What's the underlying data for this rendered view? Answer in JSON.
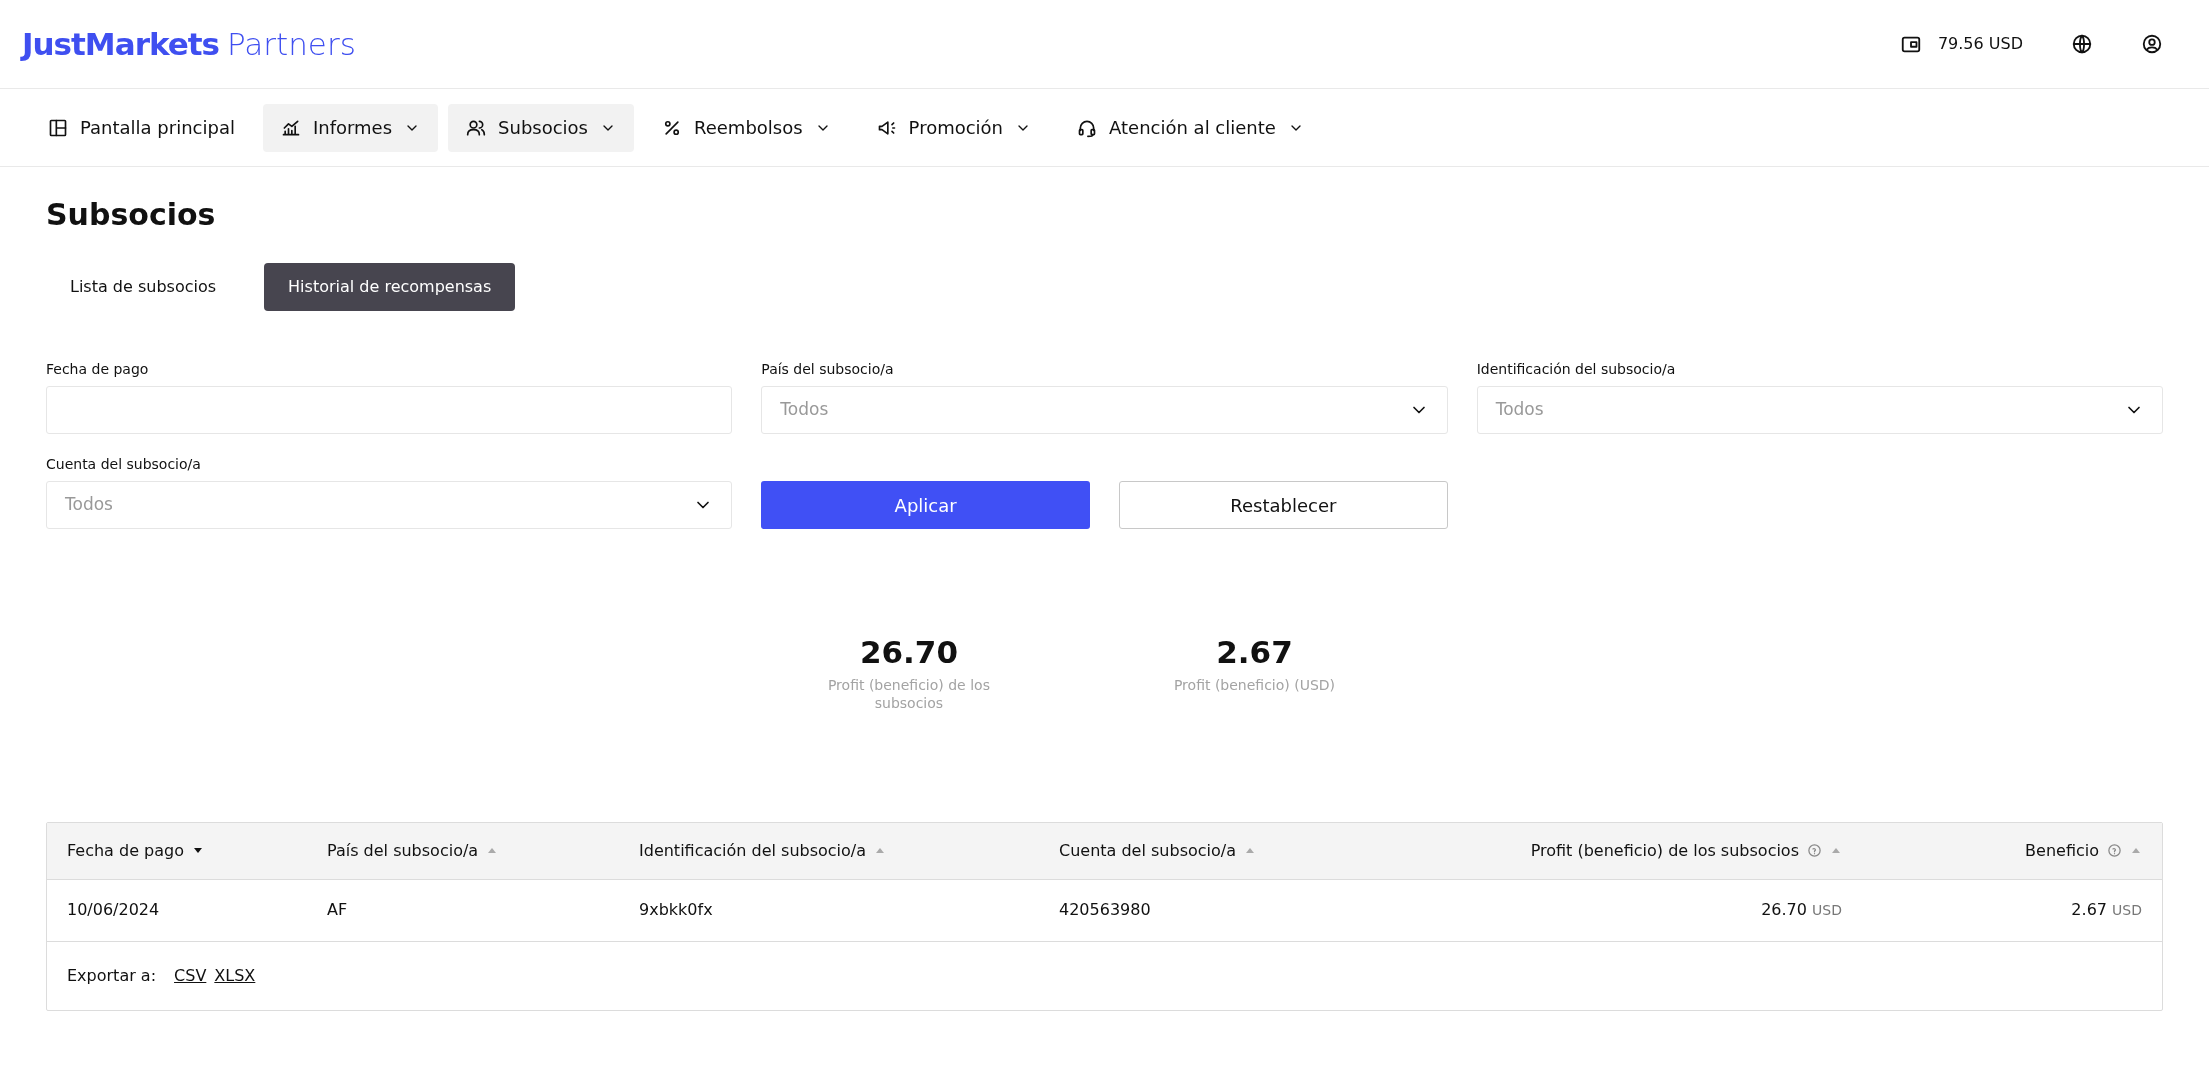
{
  "logo": {
    "brand": "JustMarkets",
    "suffix": "Partners"
  },
  "header": {
    "balance": "79.56 USD"
  },
  "nav": [
    {
      "label": "Pantalla principal",
      "dropdown": false,
      "selected": false
    },
    {
      "label": "Informes",
      "dropdown": true,
      "selected": true
    },
    {
      "label": "Subsocios",
      "dropdown": true,
      "selected": true
    },
    {
      "label": "Reembolsos",
      "dropdown": true,
      "selected": false
    },
    {
      "label": "Promoción",
      "dropdown": true,
      "selected": false
    },
    {
      "label": "Atención al cliente",
      "dropdown": true,
      "selected": false
    }
  ],
  "page_title": "Subsocios",
  "tabs": [
    {
      "label": "Lista de subsocios",
      "selected": false
    },
    {
      "label": "Historial de recompensas",
      "selected": true
    }
  ],
  "filters": [
    {
      "kind": "input",
      "label": "Fecha de pago"
    },
    {
      "kind": "select",
      "label": "País del subsocio/a",
      "placeholder": "Todos"
    },
    {
      "kind": "select",
      "label": "Identificación del subsocio/a",
      "placeholder": "Todos"
    },
    {
      "kind": "select",
      "label": "Cuenta del subsocio/a",
      "placeholder": "Todos"
    }
  ],
  "buttons": [
    {
      "kind": "primary",
      "label": "Aplicar"
    },
    {
      "kind": "outline",
      "label": "Restablecer"
    }
  ],
  "stats": [
    {
      "value": "26.70",
      "label": "Profit (beneficio) de los subsocios"
    },
    {
      "value": "2.67",
      "label": "Profit (beneficio) (USD)"
    }
  ],
  "table": {
    "columns": [
      {
        "label": "Fecha de pago",
        "kind": "text",
        "selected": true,
        "help": false
      },
      {
        "label": "País del subsocio/a",
        "kind": "text",
        "selected": false,
        "help": false
      },
      {
        "label": "Identificación del subsocio/a",
        "kind": "text",
        "selected": false,
        "help": false
      },
      {
        "label": "Cuenta del subsocio/a",
        "kind": "text",
        "selected": false,
        "help": false
      },
      {
        "label": "Profit (beneficio) de los subsocios",
        "kind": "amount",
        "selected": false,
        "help": true
      },
      {
        "label": "Beneficio",
        "kind": "amount",
        "selected": false,
        "help": true
      }
    ],
    "rows": [
      [
        {
          "value": "10/06/2024"
        },
        {
          "value": "AF"
        },
        {
          "value": "9xbkk0fx"
        },
        {
          "value": "420563980"
        },
        {
          "value": "26.70",
          "unit": "USD"
        },
        {
          "value": "2.67",
          "unit": "USD"
        }
      ]
    ],
    "export": {
      "label": "Exportar a:",
      "links": [
        "CSV",
        "XLSX"
      ]
    }
  }
}
